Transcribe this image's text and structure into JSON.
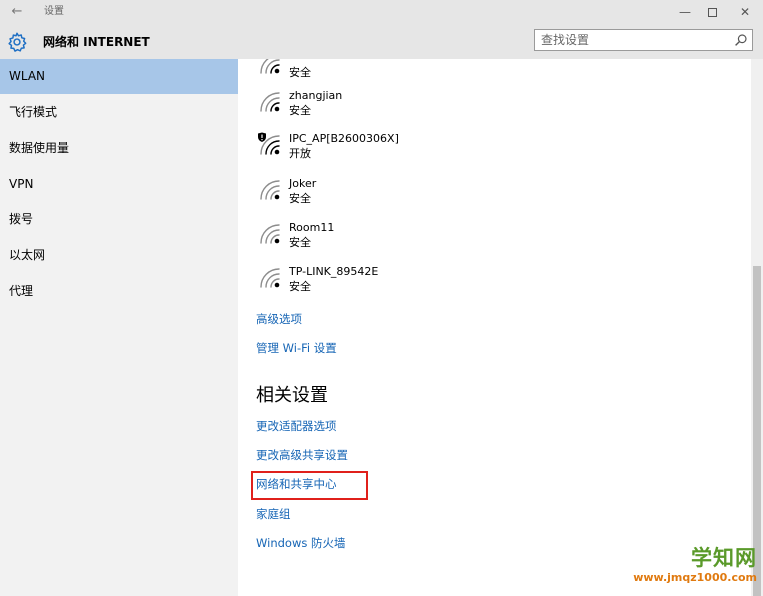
{
  "window": {
    "title": "设置",
    "back_glyph": "←",
    "minimize_glyph": "—",
    "close_glyph": "✕"
  },
  "header": {
    "title": "网络和 INTERNET",
    "icon": "gear-icon"
  },
  "search": {
    "placeholder": "查找设置",
    "icon": "search-icon"
  },
  "sidebar": {
    "items": [
      {
        "label": "WLAN",
        "active": true
      },
      {
        "label": "飞行模式"
      },
      {
        "label": "数据使用量"
      },
      {
        "label": "VPN"
      },
      {
        "label": "拨号"
      },
      {
        "label": "以太网"
      },
      {
        "label": "代理"
      }
    ]
  },
  "networks": [
    {
      "name": "",
      "status": "安全",
      "secured": true
    },
    {
      "name": "zhangjian",
      "status": "安全",
      "secured": true
    },
    {
      "name": "IPC_AP[B2600306X]",
      "status": "开放",
      "secured": false
    },
    {
      "name": "Joker",
      "status": "安全",
      "secured": true
    },
    {
      "name": "Room11",
      "status": "安全",
      "secured": true
    },
    {
      "name": "TP-LINK_89542E",
      "status": "安全",
      "secured": true
    }
  ],
  "links": {
    "advanced": "高级选项",
    "manage_wifi": "管理 Wi-Fi 设置"
  },
  "related": {
    "title": "相关设置",
    "items": [
      "更改适配器选项",
      "更改高级共享设置",
      "网络和共享中心",
      "家庭组",
      "Windows 防火墙"
    ]
  },
  "watermark": {
    "main": "学知网",
    "url": "www.jmqz1000.com"
  },
  "colors": {
    "accent_link": "#1665b5",
    "active_nav": "#a7c6e8",
    "highlight": "#e0201b"
  }
}
